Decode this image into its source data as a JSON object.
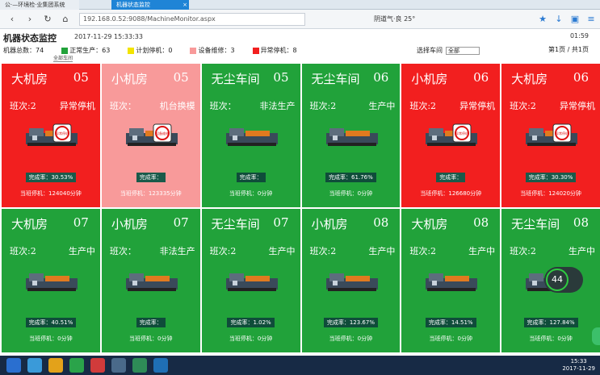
{
  "browser": {
    "tab1": "公·—环境检·业集团系统",
    "tab2": "机器状态监控",
    "url": "192.168.0.52:9088/MachineMonitor.aspx",
    "weather": "阴道气·良 25°",
    "close_glyph": "×"
  },
  "header": {
    "title": "机器状态监控",
    "datetime": "2017-11-29 15:33:33",
    "clock": "01:59",
    "page_info": "第1页 / 共1页",
    "region_label": "选择车间",
    "region_value": "全部",
    "sub_link": "全部车间"
  },
  "stats": {
    "total": "机器总数：74",
    "normal": "正常生产：63",
    "plan_stop": "计划停机：0",
    "maintenance": "设备维修：3",
    "abnormal": "异常停机：8"
  },
  "colors": {
    "normal": "#21a23a",
    "plan_stop": "#f3e400",
    "maintenance": "#f89a9a",
    "abnormal": "#f21f1f"
  },
  "machines": [
    {
      "name": "大机房",
      "no": "05",
      "shift": "班次:2",
      "status": "异常停机",
      "color": "red",
      "rate": "完成率：30.53%",
      "stop": "当班停机：124040分钟",
      "badge": "异常停机"
    },
    {
      "name": "小机房",
      "no": "05",
      "shift": "班次：",
      "status": "机台换模",
      "color": "pink",
      "rate": "完成率：",
      "stop": "当班停机：123335分钟",
      "badge": "设备维修"
    },
    {
      "name": "无尘车间",
      "no": "05",
      "shift": "班次：",
      "status": "非法生产",
      "color": "green",
      "rate": "完成率：",
      "stop": "当班停机：0分钟",
      "badge": ""
    },
    {
      "name": "无尘车间",
      "no": "06",
      "shift": "班次:2",
      "status": "生产中",
      "color": "green",
      "rate": "完成率：61.76%",
      "stop": "当班停机：0分钟",
      "badge": ""
    },
    {
      "name": "小机房",
      "no": "06",
      "shift": "班次:2",
      "status": "异常停机",
      "color": "red",
      "rate": "完成率：",
      "stop": "当班停机：126680分钟",
      "badge": "异常停机"
    },
    {
      "name": "大机房",
      "no": "06",
      "shift": "班次:2",
      "status": "异常停机",
      "color": "red",
      "rate": "完成率：30.30%",
      "stop": "当班停机：124020分钟",
      "badge": "异常停机"
    },
    {
      "name": "大机房",
      "no": "07",
      "shift": "班次:2",
      "status": "生产中",
      "color": "green",
      "rate": "完成率：40.51%",
      "stop": "当班停机：0分钟",
      "badge": ""
    },
    {
      "name": "小机房",
      "no": "07",
      "shift": "班次：",
      "status": "非法生产",
      "color": "green",
      "rate": "完成率：",
      "stop": "当班停机：0分钟",
      "badge": ""
    },
    {
      "name": "无尘车间",
      "no": "07",
      "shift": "班次:2",
      "status": "生产中",
      "color": "green",
      "rate": "完成率：1.02%",
      "stop": "当班停机：0分钟",
      "badge": ""
    },
    {
      "name": "小机房",
      "no": "08",
      "shift": "班次:2",
      "status": "生产中",
      "color": "green",
      "rate": "完成率：123.67%",
      "stop": "当班停机：0分钟",
      "badge": ""
    },
    {
      "name": "大机房",
      "no": "08",
      "shift": "班次:2",
      "status": "生产中",
      "color": "green",
      "rate": "完成率：14.51%",
      "stop": "当班停机：0分钟",
      "badge": ""
    },
    {
      "name": "无尘车间",
      "no": "08",
      "shift": "班次:2",
      "status": "生产中",
      "color": "green",
      "rate": "完成率：127.84%",
      "stop": "当班停机：0分钟",
      "badge": ""
    }
  ],
  "widget": {
    "value": "44"
  },
  "taskbar": {
    "time": "15:33",
    "date": "2017-11-29"
  }
}
